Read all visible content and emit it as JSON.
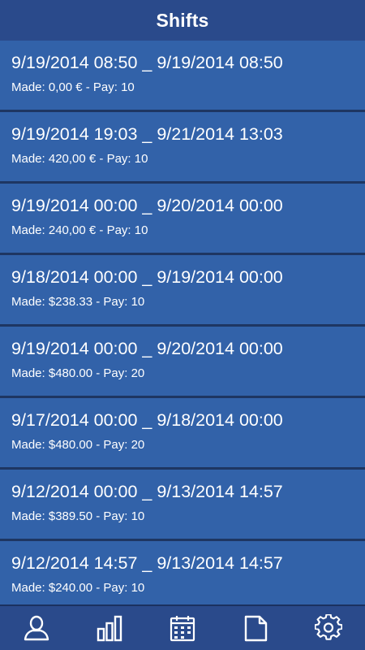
{
  "header": {
    "title": "Shifts"
  },
  "shifts": [
    {
      "range": "9/19/2014 08:50 _ 9/19/2014 08:50",
      "summary": "Made: 0,00 € - Pay: 10"
    },
    {
      "range": "9/19/2014 19:03 _ 9/21/2014 13:03",
      "summary": "Made: 420,00 € - Pay: 10"
    },
    {
      "range": "9/19/2014 00:00 _ 9/20/2014 00:00",
      "summary": "Made: 240,00 € - Pay: 10"
    },
    {
      "range": "9/18/2014 00:00 _ 9/19/2014 00:00",
      "summary": "Made: $238.33 - Pay: 10"
    },
    {
      "range": "9/19/2014 00:00 _ 9/20/2014 00:00",
      "summary": "Made: $480.00 - Pay: 20"
    },
    {
      "range": "9/17/2014 00:00 _ 9/18/2014 00:00",
      "summary": "Made: $480.00 - Pay: 20"
    },
    {
      "range": "9/12/2014 00:00 _ 9/13/2014 14:57",
      "summary": "Made: $389.50 - Pay: 10"
    },
    {
      "range": "9/12/2014 14:57 _ 9/13/2014 14:57",
      "summary": "Made: $240.00 - Pay: 10"
    }
  ],
  "tabbar": {
    "tabs": [
      {
        "icon": "person-icon"
      },
      {
        "icon": "bar-chart-icon"
      },
      {
        "icon": "calendar-icon"
      },
      {
        "icon": "document-icon"
      },
      {
        "icon": "gear-icon"
      }
    ]
  },
  "colors": {
    "header": "#2a4a8b",
    "row": "#3262a9",
    "row_divider": "#1e3662",
    "text": "#ffffff"
  }
}
